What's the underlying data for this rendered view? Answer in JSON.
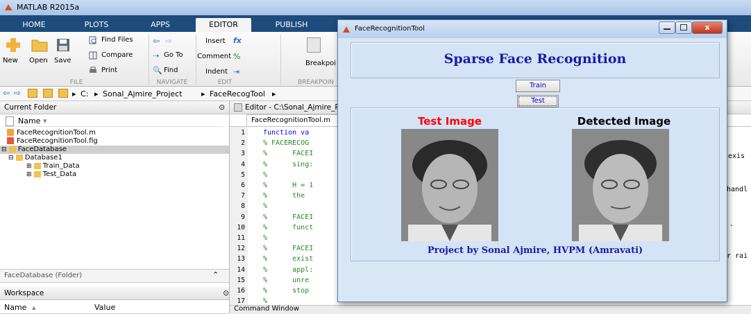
{
  "app": {
    "title": "MATLAB R2015a"
  },
  "tabs": [
    "HOME",
    "PLOTS",
    "APPS",
    "EDITOR",
    "PUBLISH"
  ],
  "ribbon": {
    "new_label": "New",
    "open_label": "Open",
    "save_label": "Save",
    "find_files": "Find Files",
    "compare": "Compare",
    "print": "Print",
    "go_to": "Go To",
    "find": "Find",
    "insert": "Insert",
    "comment": "Comment",
    "indent": "Indent",
    "breakpoints": "Breakpoi",
    "groups": {
      "file": "FILE",
      "navigate": "NAVIGATE",
      "edit": "EDIT",
      "breakpoints": "BREAKPOIN"
    }
  },
  "address": {
    "drive": "C:",
    "folder1": "Sonal_Ajmire_Project",
    "folder2": "FaceRecogTool"
  },
  "current_folder": {
    "title": "Current Folder",
    "name_header": "Name",
    "items": [
      "FaceRecognitionTool.m",
      "FaceRecognitionTool.fig",
      "FaceDatabase",
      "Database1",
      "Train_Data",
      "Test_Data"
    ],
    "footer": "FaceDatabase (Folder)"
  },
  "workspace": {
    "title": "Workspace",
    "col_name": "Name",
    "col_value": "Value"
  },
  "editor": {
    "title": "Editor - C:\\Sonal_Ajmire_P",
    "file_tab": "FaceRecognitionTool.m",
    "lines": [
      {
        "n": "1",
        "t": "function va"
      },
      {
        "n": "2",
        "t": "% FACERECOG"
      },
      {
        "n": "3",
        "t": "%      FACEI"
      },
      {
        "n": "4",
        "t": "%      sing:"
      },
      {
        "n": "5",
        "t": "%"
      },
      {
        "n": "6",
        "t": "%      H = 1"
      },
      {
        "n": "7",
        "t": "%      the"
      },
      {
        "n": "8",
        "t": "%"
      },
      {
        "n": "9",
        "t": "%      FACEI"
      },
      {
        "n": "10",
        "t": "%      funct"
      },
      {
        "n": "11",
        "t": "%"
      },
      {
        "n": "12",
        "t": "%      FACEI"
      },
      {
        "n": "13",
        "t": "%      exist"
      },
      {
        "n": "14",
        "t": "%      appl:"
      },
      {
        "n": "15",
        "t": "%      unre"
      },
      {
        "n": "16",
        "t": "%      stop"
      },
      {
        "n": "17",
        "t": "%"
      }
    ],
    "right_frag": [
      "exis",
      "handl",
      ".",
      "r rai"
    ],
    "command_window": "Command Window"
  },
  "figure": {
    "window_title": "FaceRecognitionTool",
    "heading": "Sparse Face Recognition",
    "train_label": "Train",
    "test_label": "Test",
    "test_image_label": "Test Image",
    "detected_image_label": "Detected Image",
    "credit": "Project by Sonal Ajmire, HVPM (Amravati)"
  },
  "colors": {
    "heading": "#1a1aa6",
    "test_image": "#ff0000",
    "detected_image": "#000000",
    "credit": "#1a1aa6"
  }
}
